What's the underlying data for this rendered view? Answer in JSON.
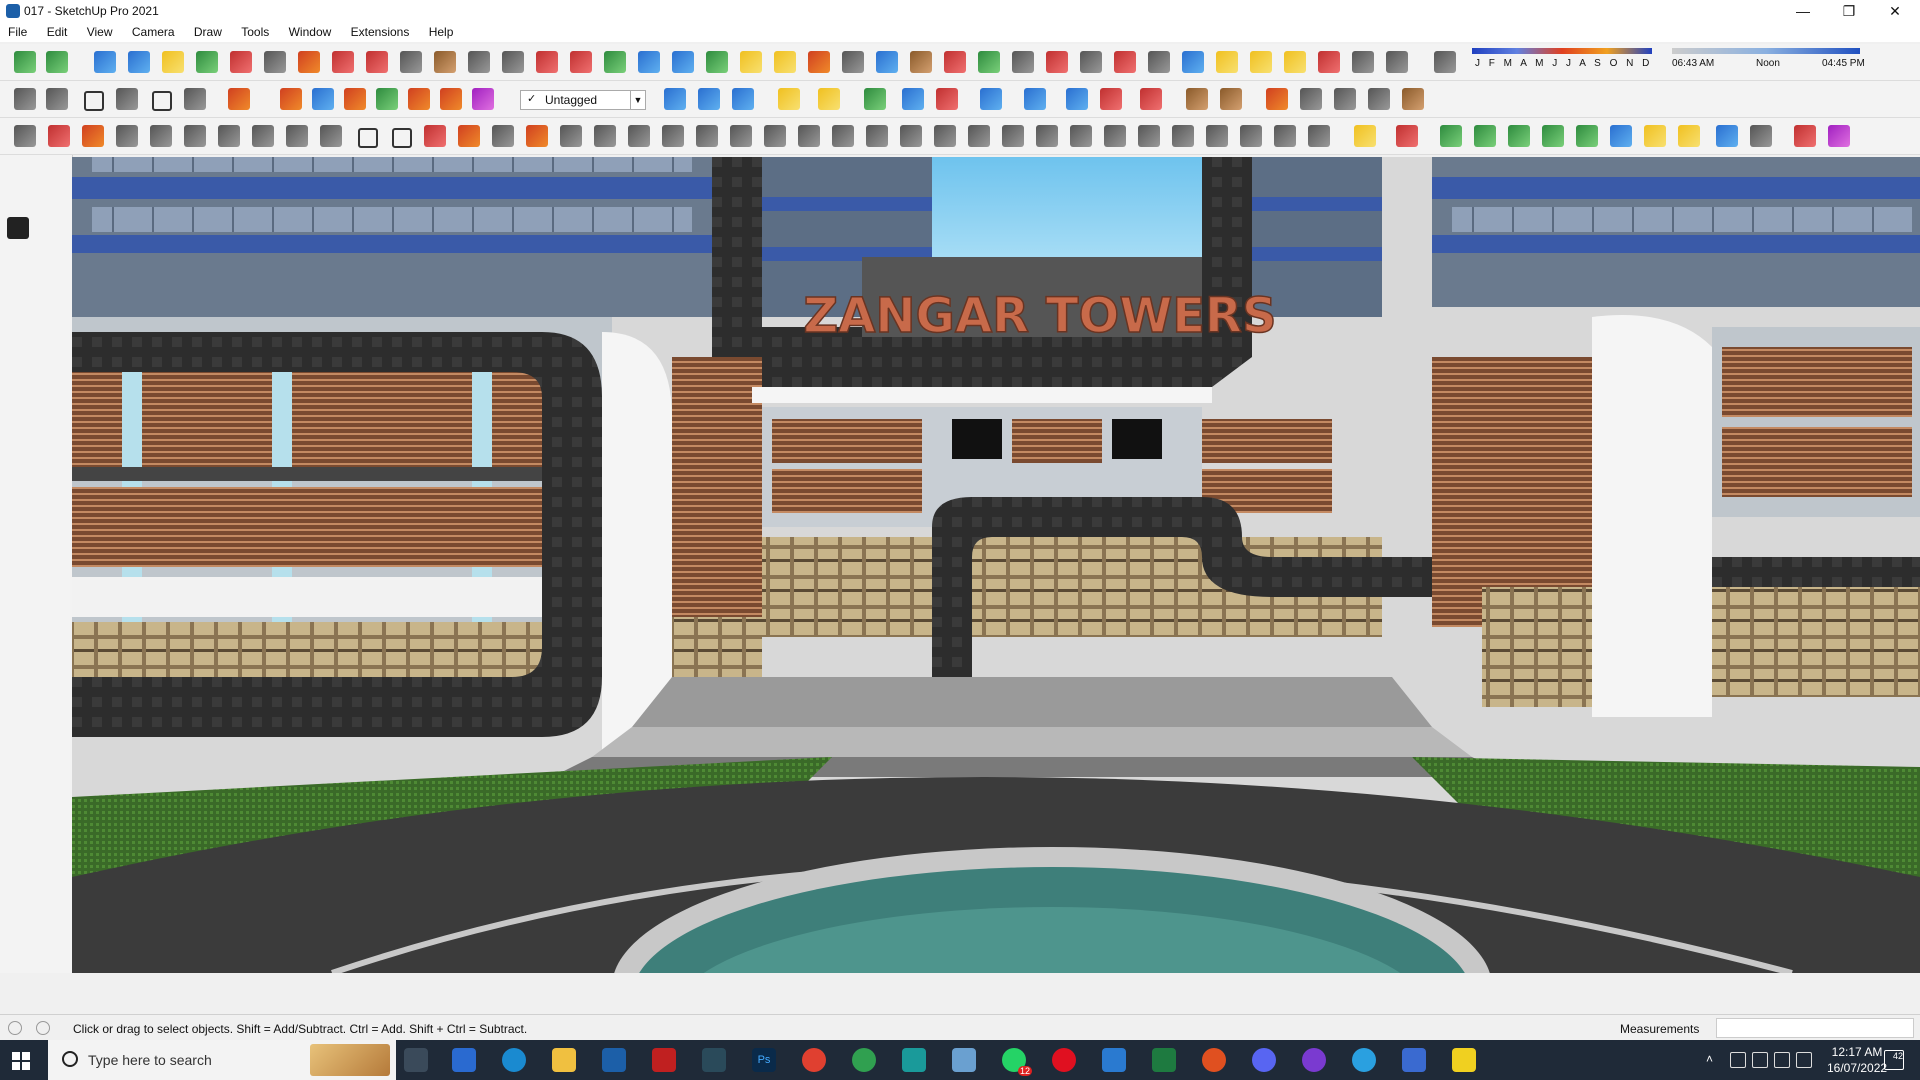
{
  "window": {
    "title": "017 - SketchUp Pro 2021",
    "minimize": "—",
    "maximize": "❐",
    "close": "✕"
  },
  "menu": [
    "File",
    "Edit",
    "View",
    "Camera",
    "Draw",
    "Tools",
    "Window",
    "Extensions",
    "Help"
  ],
  "tag_selector": {
    "value": "Untagged",
    "check": "✓"
  },
  "shadow": {
    "months": "J F M A M J J A S O N D",
    "time_start": "06:43 AM",
    "time_mid": "Noon",
    "time_end": "04:45 PM"
  },
  "scene": {
    "sign_text": "ZANGAR TOWERS"
  },
  "status": {
    "hint": "Click or drag to select objects. Shift = Add/Subtract. Ctrl = Add. Shift + Ctrl = Subtract.",
    "measurements_label": "Measurements",
    "measurements_value": ""
  },
  "taskbar": {
    "search_placeholder": "Type here to search",
    "time": "12:17 AM",
    "date": "16/07/2022",
    "notifications": "42",
    "whatsapp_badge": "12"
  },
  "colors": {
    "sky": "#8fd0f0",
    "grass": "#3a6a28",
    "road": "#3b3b3b",
    "sign": "#c86a4a",
    "glass_blue": "#3a5aa8"
  }
}
